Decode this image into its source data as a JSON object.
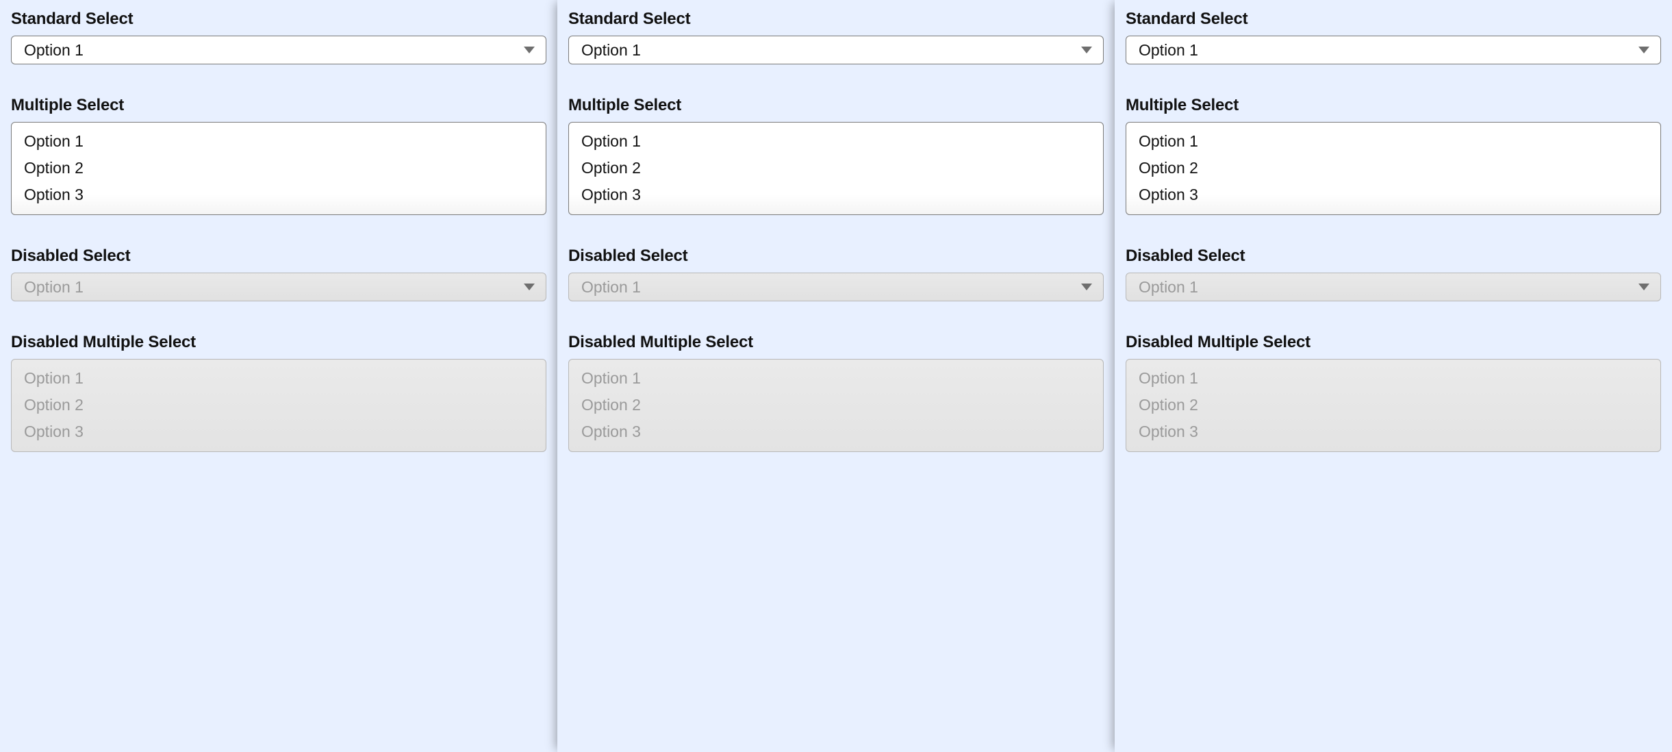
{
  "columns": [
    {
      "standard": {
        "label": "Standard Select",
        "value": "Option 1"
      },
      "multiple": {
        "label": "Multiple Select",
        "options": [
          "Option 1",
          "Option 2",
          "Option 3"
        ]
      },
      "disabled": {
        "label": "Disabled Select",
        "value": "Option 1"
      },
      "disabledMultiple": {
        "label": "Disabled Multiple Select",
        "options": [
          "Option 1",
          "Option 2",
          "Option 3"
        ]
      }
    },
    {
      "standard": {
        "label": "Standard Select",
        "value": "Option 1"
      },
      "multiple": {
        "label": "Multiple Select",
        "options": [
          "Option 1",
          "Option 2",
          "Option 3"
        ]
      },
      "disabled": {
        "label": "Disabled Select",
        "value": "Option 1"
      },
      "disabledMultiple": {
        "label": "Disabled Multiple Select",
        "options": [
          "Option 1",
          "Option 2",
          "Option 3"
        ]
      }
    },
    {
      "standard": {
        "label": "Standard Select",
        "value": "Option 1"
      },
      "multiple": {
        "label": "Multiple Select",
        "options": [
          "Option 1",
          "Option 2",
          "Option 3"
        ]
      },
      "disabled": {
        "label": "Disabled Select",
        "value": "Option 1"
      },
      "disabledMultiple": {
        "label": "Disabled Multiple Select",
        "options": [
          "Option 1",
          "Option 2",
          "Option 3"
        ]
      }
    }
  ]
}
